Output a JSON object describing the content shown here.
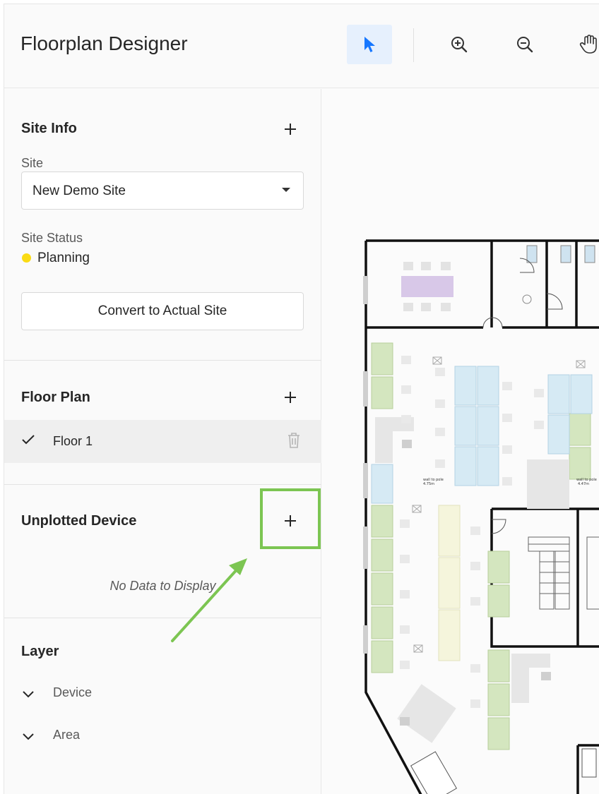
{
  "header": {
    "title": "Floorplan Designer",
    "tools": [
      {
        "name": "select-tool",
        "icon": "cursor-icon",
        "active": true
      },
      {
        "name": "zoom-in-tool",
        "icon": "zoom-in-icon",
        "active": false
      },
      {
        "name": "zoom-out-tool",
        "icon": "zoom-out-icon",
        "active": false
      },
      {
        "name": "pan-tool",
        "icon": "hand-icon",
        "active": false
      }
    ]
  },
  "site_info": {
    "title": "Site Info",
    "site_label": "Site",
    "site_value": "New Demo Site",
    "status_label": "Site Status",
    "status_value": "Planning",
    "status_color": "#fadb14",
    "convert_button": "Convert to Actual Site"
  },
  "floor_plan": {
    "title": "Floor Plan",
    "floors": [
      {
        "label": "Floor 1",
        "selected": true
      }
    ]
  },
  "unplotted": {
    "title": "Unplotted Device",
    "empty_text": "No Data to Display"
  },
  "layer": {
    "title": "Layer",
    "items": [
      {
        "label": "Device"
      },
      {
        "label": "Area"
      }
    ]
  },
  "colors": {
    "accent": "#1677ff",
    "highlight": "#7cc552",
    "active_tool_bg": "#e6f0fd"
  }
}
